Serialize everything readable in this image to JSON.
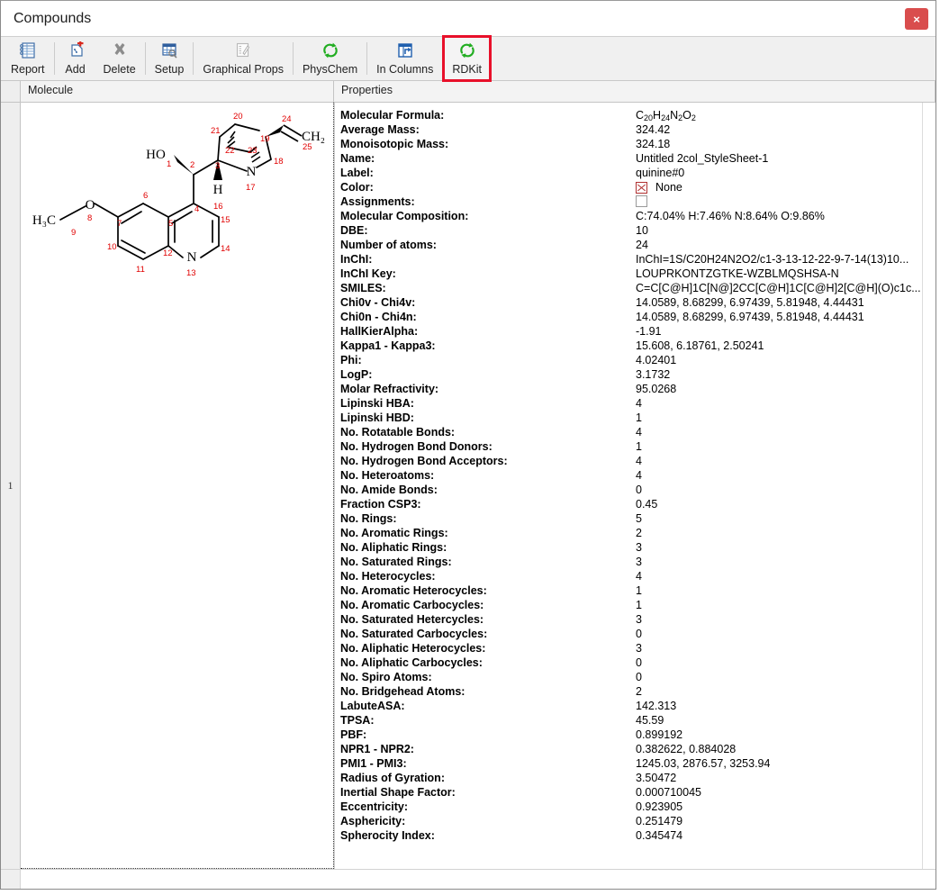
{
  "window": {
    "title": "Compounds",
    "close_label": "×"
  },
  "toolbar": {
    "items": [
      {
        "label": "Report",
        "icon": "report-icon"
      },
      {
        "label": "Add",
        "icon": "add-icon"
      },
      {
        "label": "Delete",
        "icon": "delete-icon"
      },
      {
        "label": "Setup",
        "icon": "setup-icon"
      },
      {
        "label": "Graphical Props",
        "icon": "graphical-props-icon"
      },
      {
        "label": "PhysChem",
        "icon": "physchem-refresh-icon"
      },
      {
        "label": "In Columns",
        "icon": "in-columns-icon"
      },
      {
        "label": "RDKit",
        "icon": "rdkit-refresh-icon"
      }
    ],
    "highlight_color": "#e8102a",
    "highlighted_index": 7
  },
  "grid": {
    "headers": {
      "molecule": "Molecule",
      "properties": "Properties"
    },
    "row_number": "1"
  },
  "molecule": {
    "atom_labels": [
      "HO",
      "H",
      "N",
      "O",
      "H₃C",
      "CH₂"
    ],
    "numbers": [
      "1",
      "2",
      "3",
      "4",
      "5",
      "6",
      "7",
      "8",
      "9",
      "10",
      "11",
      "12",
      "13",
      "14",
      "15",
      "16",
      "17",
      "18",
      "19",
      "20",
      "21",
      "22",
      "23",
      "24",
      "25"
    ],
    "number_color": "#e00000",
    "bond_color": "#000000"
  },
  "properties": [
    {
      "name": "Molecular Formula:",
      "value": "C20H24N2O2",
      "value_kind": "formula",
      "formula": [
        [
          "C",
          ""
        ],
        [
          "",
          ""
        ],
        [
          "H",
          ""
        ],
        [
          "",
          ""
        ],
        [
          "N",
          ""
        ],
        [
          "",
          ""
        ],
        [
          "O",
          ""
        ],
        [
          "",
          ""
        ]
      ]
    },
    {
      "name": "Average Mass:",
      "value": "324.42"
    },
    {
      "name": "Monoisotopic Mass:",
      "value": "324.18"
    },
    {
      "name": "Name:",
      "value": "Untitled 2col_StyleSheet-1"
    },
    {
      "name": "Label:",
      "value": "quinine#0"
    },
    {
      "name": "Color:",
      "value": "None",
      "value_kind": "color-none"
    },
    {
      "name": "Assignments:",
      "value": "",
      "value_kind": "checkbox"
    },
    {
      "name": "Molecular Composition:",
      "value": "C:74.04% H:7.46% N:8.64% O:9.86%"
    },
    {
      "name": "DBE:",
      "value": "10"
    },
    {
      "name": "Number of atoms:",
      "value": "24"
    },
    {
      "name": "InChI:",
      "value": "InChI=1S/C20H24N2O2/c1-3-13-12-22-9-7-14(13)10..."
    },
    {
      "name": "InChI Key:",
      "value": "LOUPRKONTZGTKE-WZBLMQSHSA-N"
    },
    {
      "name": "SMILES:",
      "value": "C=C[C@H]1C[N@]2CC[C@H]1C[C@H]2[C@H](O)c1c..."
    },
    {
      "name": "Chi0v - Chi4v:",
      "value": "14.0589, 8.68299, 6.97439, 5.81948, 4.44431"
    },
    {
      "name": "Chi0n - Chi4n:",
      "value": "14.0589, 8.68299, 6.97439, 5.81948, 4.44431"
    },
    {
      "name": "HallKierAlpha:",
      "value": "-1.91"
    },
    {
      "name": "Kappa1 - Kappa3:",
      "value": "15.608, 6.18761, 2.50241"
    },
    {
      "name": "Phi:",
      "value": "4.02401"
    },
    {
      "name": "LogP:",
      "value": "3.1732"
    },
    {
      "name": "Molar Refractivity:",
      "value": "95.0268"
    },
    {
      "name": "Lipinski HBA:",
      "value": "4"
    },
    {
      "name": "Lipinski HBD:",
      "value": "1"
    },
    {
      "name": "No. Rotatable Bonds:",
      "value": "4"
    },
    {
      "name": "No. Hydrogen Bond Donors:",
      "value": "1"
    },
    {
      "name": "No. Hydrogen Bond Acceptors:",
      "value": "4"
    },
    {
      "name": "No. Heteroatoms:",
      "value": "4"
    },
    {
      "name": "No. Amide Bonds:",
      "value": "0"
    },
    {
      "name": "Fraction CSP3:",
      "value": "0.45"
    },
    {
      "name": "No. Rings:",
      "value": "5"
    },
    {
      "name": "No. Aromatic Rings:",
      "value": "2"
    },
    {
      "name": "No. Aliphatic Rings:",
      "value": "3"
    },
    {
      "name": "No. Saturated Rings:",
      "value": "3"
    },
    {
      "name": "No. Heterocycles:",
      "value": "4"
    },
    {
      "name": "No. Aromatic Heterocycles:",
      "value": "1"
    },
    {
      "name": "No. Aromatic Carbocycles:",
      "value": "1"
    },
    {
      "name": "No. Saturated Hetercycles:",
      "value": "3"
    },
    {
      "name": "No. Saturated Carbocycles:",
      "value": "0"
    },
    {
      "name": "No. Aliphatic Heterocycles:",
      "value": "3"
    },
    {
      "name": "No. Aliphatic Carbocycles:",
      "value": "0"
    },
    {
      "name": "No. Spiro Atoms:",
      "value": "0"
    },
    {
      "name": "No. Bridgehead Atoms:",
      "value": "2"
    },
    {
      "name": "LabuteASA:",
      "value": "142.313"
    },
    {
      "name": "TPSA:",
      "value": "45.59"
    },
    {
      "name": "PBF:",
      "value": "0.899192"
    },
    {
      "name": "NPR1 - NPR2:",
      "value": "0.382622, 0.884028"
    },
    {
      "name": "PMI1 - PMI3:",
      "value": "1245.03, 2876.57, 3253.94"
    },
    {
      "name": "Radius of Gyration:",
      "value": "3.50472"
    },
    {
      "name": "Inertial Shape Factor:",
      "value": "0.000710045"
    },
    {
      "name": "Eccentricity:",
      "value": "0.923905"
    },
    {
      "name": "Asphericity:",
      "value": "0.251479"
    },
    {
      "name": "Spherocity Index:",
      "value": "0.345474"
    }
  ]
}
